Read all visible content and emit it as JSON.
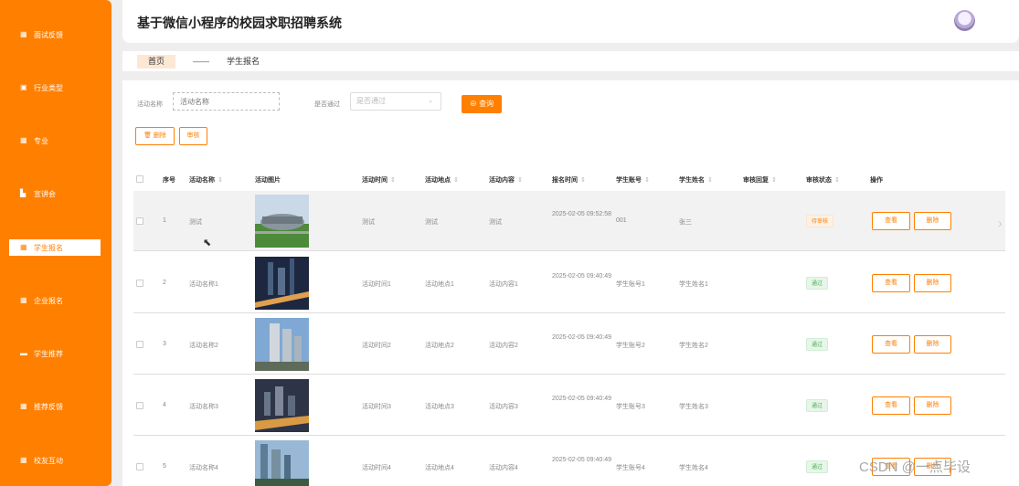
{
  "app": {
    "title": "基于微信小程序的校园求职招聘系统"
  },
  "sidebar": {
    "items": [
      {
        "label": "面试反馈",
        "icon": "grid-icon"
      },
      {
        "label": "行业类型",
        "icon": "clipboard-icon"
      },
      {
        "label": "专业",
        "icon": "grid-icon"
      },
      {
        "label": "宣讲会",
        "icon": "briefcase-icon"
      },
      {
        "label": "学生报名",
        "icon": "grid-icon",
        "active": true
      },
      {
        "label": "企业报名",
        "icon": "grid-icon"
      },
      {
        "label": "学生推荐",
        "icon": "monitor-icon"
      },
      {
        "label": "推荐反馈",
        "icon": "grid-icon"
      },
      {
        "label": "校友互动",
        "icon": "grid-icon"
      }
    ]
  },
  "breadcrumb": {
    "home": "首页",
    "separator": "——",
    "current": "学生报名"
  },
  "search": {
    "name_label": "活动名称",
    "name_placeholder": "活动名称",
    "pass_label": "是否通过",
    "pass_placeholder": "是否通过",
    "query_button": "查询"
  },
  "actions": {
    "delete": "删除",
    "review": "审核"
  },
  "table": {
    "columns": {
      "index": "序号",
      "name": "活动名称",
      "image": "活动图片",
      "time": "活动时间",
      "place": "活动地点",
      "content": "活动内容",
      "signup_time": "报名时间",
      "account": "学生账号",
      "student_name": "学生姓名",
      "reply": "审核回复",
      "status": "审核状态",
      "ops": "操作"
    },
    "view_label": "查看",
    "delete_label": "删除",
    "rows": [
      {
        "index": "1",
        "name": "测试",
        "time": "测试",
        "place": "测试",
        "content": "测试",
        "signup_time": "2025-02-05 09:52:58",
        "account": "001",
        "student_name": "张三",
        "reply": "",
        "status": "待审核",
        "status_type": "pending"
      },
      {
        "index": "2",
        "name": "活动名称1",
        "time": "活动时间1",
        "place": "活动地点1",
        "content": "活动内容1",
        "signup_time": "2025-02-05 09:40:49",
        "account": "学生账号1",
        "student_name": "学生姓名1",
        "reply": "",
        "status": "通过",
        "status_type": "passed"
      },
      {
        "index": "3",
        "name": "活动名称2",
        "time": "活动时间2",
        "place": "活动地点2",
        "content": "活动内容2",
        "signup_time": "2025-02-05 09:40:49",
        "account": "学生账号2",
        "student_name": "学生姓名2",
        "reply": "",
        "status": "通过",
        "status_type": "passed"
      },
      {
        "index": "4",
        "name": "活动名称3",
        "time": "活动时间3",
        "place": "活动地点3",
        "content": "活动内容3",
        "signup_time": "2025-02-05 09:40:49",
        "account": "学生账号3",
        "student_name": "学生姓名3",
        "reply": "",
        "status": "通过",
        "status_type": "passed"
      },
      {
        "index": "5",
        "name": "活动名称4",
        "time": "活动时间4",
        "place": "活动地点4",
        "content": "活动内容4",
        "signup_time": "2025-02-05 09:40:49",
        "account": "学生账号4",
        "student_name": "学生姓名4",
        "reply": "",
        "status": "通过",
        "status_type": "passed"
      }
    ]
  },
  "watermark": "CSDN @一点毕设",
  "colors": {
    "accent": "#ff7f00",
    "pass": "#4caf50"
  }
}
